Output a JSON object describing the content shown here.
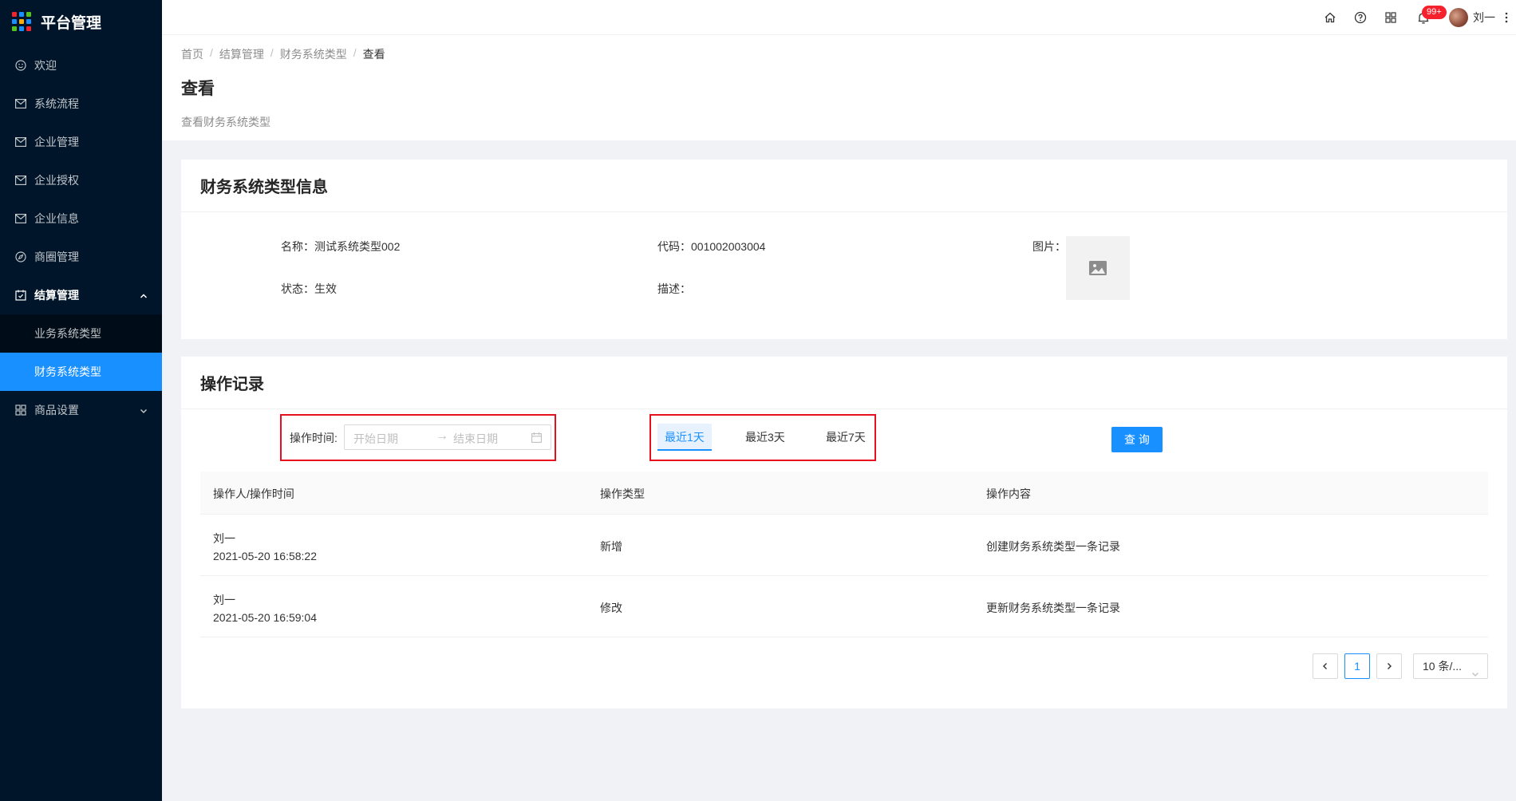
{
  "app": {
    "title": "平台管理"
  },
  "sidebar": {
    "items": [
      {
        "label": "欢迎",
        "icon": "smile-icon"
      },
      {
        "label": "系统流程",
        "icon": "mail-icon"
      },
      {
        "label": "企业管理",
        "icon": "mail-icon"
      },
      {
        "label": "企业授权",
        "icon": "mail-icon"
      },
      {
        "label": "企业信息",
        "icon": "mail-icon"
      },
      {
        "label": "商圈管理",
        "icon": "compass-icon"
      },
      {
        "label": "结算管理",
        "icon": "calendar-icon",
        "expanded": true
      },
      {
        "label": "商品设置",
        "icon": "appstore-icon"
      }
    ],
    "submenu": [
      {
        "label": "业务系统类型"
      },
      {
        "label": "财务系统类型",
        "active": true
      }
    ]
  },
  "topbar": {
    "notification_badge": "99+",
    "user_name": "刘一"
  },
  "breadcrumb": [
    "首页",
    "结算管理",
    "财务系统类型",
    "查看"
  ],
  "page": {
    "title": "查看",
    "description": "查看财务系统类型"
  },
  "info_card": {
    "title": "财务系统类型信息",
    "name_label": "名称：",
    "name_value": "测试系统类型002",
    "code_label": "代码：",
    "code_value": "001002003004",
    "image_label": "图片：",
    "status_label": "状态：",
    "status_value": "生效",
    "desc_label": "描述：",
    "desc_value": ""
  },
  "records_card": {
    "title": "操作记录",
    "filter": {
      "label": "操作时间:",
      "start_placeholder": "开始日期",
      "end_placeholder": "结束日期"
    },
    "quick_ranges": [
      "最近1天",
      "最近3天",
      "最近7天"
    ],
    "active_range": "最近1天",
    "query_button": "查 询",
    "columns": [
      "操作人/操作时间",
      "操作类型",
      "操作内容"
    ],
    "rows": [
      {
        "user": "刘一",
        "time": "2021-05-20 16:58:22",
        "type": "新增",
        "content": "创建财务系统类型一条记录"
      },
      {
        "user": "刘一",
        "time": "2021-05-20 16:59:04",
        "type": "修改",
        "content": "更新财务系统类型一条记录"
      }
    ],
    "pagination": {
      "current_page": "1",
      "page_size": "10 条/..."
    }
  },
  "colors": {
    "primary": "#1890ff",
    "sidebar_bg": "#001529",
    "highlight": "#e8101e"
  }
}
